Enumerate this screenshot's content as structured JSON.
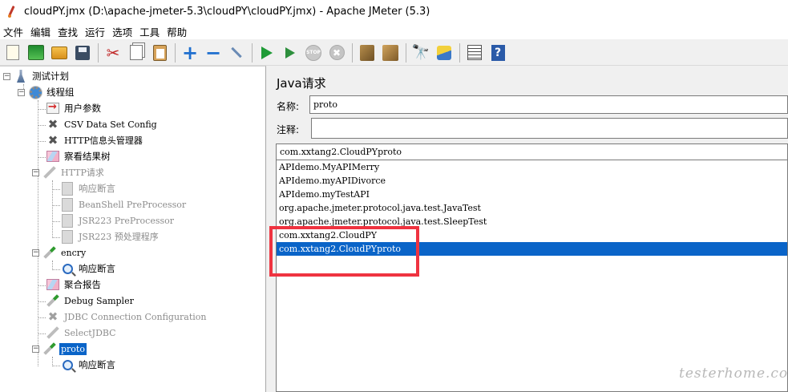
{
  "window": {
    "title": "cloudPY.jmx (D:\\apache-jmeter-5.3\\cloudPY\\cloudPY.jmx) - Apache JMeter (5.3)"
  },
  "menu": [
    "文件",
    "编辑",
    "查找",
    "运行",
    "选项",
    "工具",
    "帮助"
  ],
  "toolbar": [
    {
      "icon": "new-icon"
    },
    {
      "icon": "templates-icon"
    },
    {
      "icon": "open-icon"
    },
    {
      "icon": "save-icon"
    },
    {
      "icon": "cut-icon"
    },
    {
      "icon": "copy-icon"
    },
    {
      "icon": "paste-icon"
    },
    {
      "icon": "expand-icon"
    },
    {
      "icon": "collapse-icon"
    },
    {
      "icon": "toggle-icon"
    },
    {
      "icon": "start-icon"
    },
    {
      "icon": "start-no-timers-icon"
    },
    {
      "icon": "stop-icon"
    },
    {
      "icon": "shutdown-icon"
    },
    {
      "icon": "clear-icon"
    },
    {
      "icon": "clear-all-icon"
    },
    {
      "icon": "search-icon"
    },
    {
      "icon": "reset-search-icon"
    },
    {
      "icon": "function-helper-icon"
    },
    {
      "icon": "help-icon"
    }
  ],
  "tree": [
    {
      "label": "测试计划",
      "icon": "test-plan-icon",
      "disabled": false
    },
    {
      "label": "线程组",
      "icon": "thread-group-icon",
      "disabled": false
    },
    {
      "label": "用户参数",
      "icon": "user-parameters-icon",
      "disabled": false
    },
    {
      "label": "CSV Data Set Config",
      "icon": "config-element-icon",
      "disabled": false
    },
    {
      "label": "HTTP信息头管理器",
      "icon": "config-element-icon",
      "disabled": false
    },
    {
      "label": "察看结果树",
      "icon": "listener-icon",
      "disabled": false
    },
    {
      "label": "HTTP请求",
      "icon": "sampler-icon",
      "disabled": true
    },
    {
      "label": "响应断言",
      "icon": "assertion-icon",
      "disabled": true
    },
    {
      "label": "BeanShell PreProcessor",
      "icon": "preprocessor-icon",
      "disabled": true
    },
    {
      "label": "JSR223 PreProcessor",
      "icon": "preprocessor-icon",
      "disabled": true
    },
    {
      "label": "JSR223 预处理程序",
      "icon": "preprocessor-icon",
      "disabled": true
    },
    {
      "label": "encry",
      "icon": "sampler-icon",
      "disabled": false
    },
    {
      "label": "响应断言",
      "icon": "assertion-icon",
      "disabled": false
    },
    {
      "label": "聚合报告",
      "icon": "listener-icon",
      "disabled": false
    },
    {
      "label": "Debug Sampler",
      "icon": "sampler-icon",
      "disabled": false
    },
    {
      "label": "JDBC Connection Configuration",
      "icon": "config-element-icon",
      "disabled": true
    },
    {
      "label": "SelectJDBC",
      "icon": "sampler-icon",
      "disabled": true
    },
    {
      "label": "proto",
      "icon": "sampler-icon",
      "disabled": false,
      "selected": true
    },
    {
      "label": "响应断言",
      "icon": "assertion-icon",
      "disabled": false
    }
  ],
  "detail": {
    "heading": "Java请求",
    "name_label": "名称:",
    "name_value": "proto",
    "comment_label": "注释:",
    "comment_value": "",
    "classname_value": "com.xxtang2.CloudPYproto",
    "class_options": [
      "APIdemo.MyAPIMerry",
      "APIdemo.myAPIDivorce",
      "APIdemo.myTestAPI",
      "org.apache.jmeter.protocol.java.test.JavaTest",
      "org.apache.jmeter.protocol.java.test.SleepTest",
      "com.xxtang2.CloudPY",
      "com.xxtang2.CloudPYproto"
    ],
    "selected_class_index": 6
  },
  "watermark": "testerhome.com",
  "colors": {
    "selection": "#0a64c8",
    "highlight_box": "#ef3340"
  }
}
